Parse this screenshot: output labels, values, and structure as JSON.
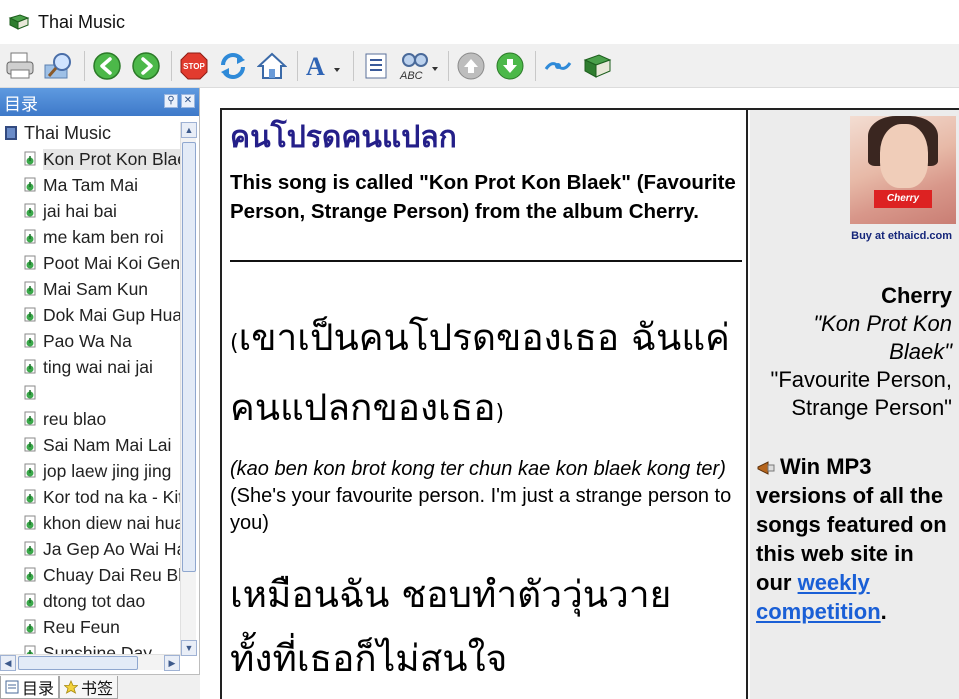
{
  "window": {
    "title": "Thai Music"
  },
  "toolbar": {
    "buttons": [
      "print-icon",
      "search-icon",
      "back-icon",
      "forward-icon",
      "stop-icon",
      "refresh-icon",
      "home-icon",
      "font-icon",
      "options-icon",
      "spell-icon",
      "up-icon",
      "down-icon",
      "sync-icon",
      "book-icon"
    ]
  },
  "left_panel": {
    "header": "目录",
    "root": "Thai Music",
    "items": [
      "Kon Prot Kon Blaek",
      "Ma Tam Mai",
      "jai hai bai",
      "me kam ben roi",
      "Poot Mai Koi Geng",
      "Mai Sam Kun",
      "Dok Mai Gup Hua Jai",
      "Pao Wa Na",
      "ting wai nai jai",
      "",
      "reu blao",
      "Sai Nam Mai Lai",
      "jop laew jing jing",
      "Kor tod na ka - Kitty",
      "khon diew nai hua jai",
      "Ja Gep Ao Wai Hai",
      "Chuay Dai Reu Blao",
      "dtong tot dao",
      "Reu Feun",
      "Sunshine Day"
    ],
    "tabs": [
      "目录",
      "书签"
    ]
  },
  "content": {
    "song_title": "คนโปรดคนแปลก",
    "intro": "This song is called \"Kon Prot Kon Blaek\" (Favourite Person, Strange Person) from the album Cherry.",
    "verse1": {
      "open_paren": "(",
      "thai": "เขาเป็นคนโปรดของเธอ ฉันแค่คนแปลกของเธอ",
      "close_paren": ")",
      "romanized": "(kao ben kon brot kong ter  chun kae kon blaek kong ter)",
      "english": "(She's your favourite person. I'm just a strange person to you)"
    },
    "verse2_thai": "เหมือนฉัน ชอบทำตัววุ่นวาย",
    "verse3_thai": "ทั้งที่เธอก็ไม่สนใจ"
  },
  "sidebar": {
    "buy_link": "Buy at ethaicd.com",
    "album_name": "Cherry",
    "album_song": "\"Kon Prot Kon Blaek\"",
    "album_english": "\"Favourite Person, Strange Person\"",
    "win_text": "Win MP3 versions of all the songs featured on this web site in our",
    "win_link": "weekly competition",
    "win_end": "."
  },
  "colors": {
    "title_thai": "#241f89",
    "link": "#1a5fd6",
    "panel_header": "#4a84d3"
  }
}
